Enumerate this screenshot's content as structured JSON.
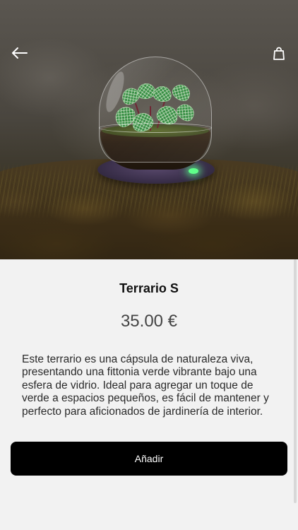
{
  "header": {
    "back_icon": "arrow-left-icon",
    "cart_icon": "shopping-bag-icon"
  },
  "product": {
    "image_alt": "",
    "title": "Terrario S",
    "price": "35.00 €",
    "description": "Este terrario es una cápsula de naturaleza viva, presentando una fittonia verde vibrante bajo una esfera de vidrio. Ideal para agregar un toque de verde a espacios pequeños, es fácil de mantener y perfecto para aficionados de jardinería de interior."
  },
  "actions": {
    "add_label": "Añadir"
  },
  "colors": {
    "background": "#f2f2f2",
    "button": "#000000",
    "button_text": "#ffffff"
  }
}
